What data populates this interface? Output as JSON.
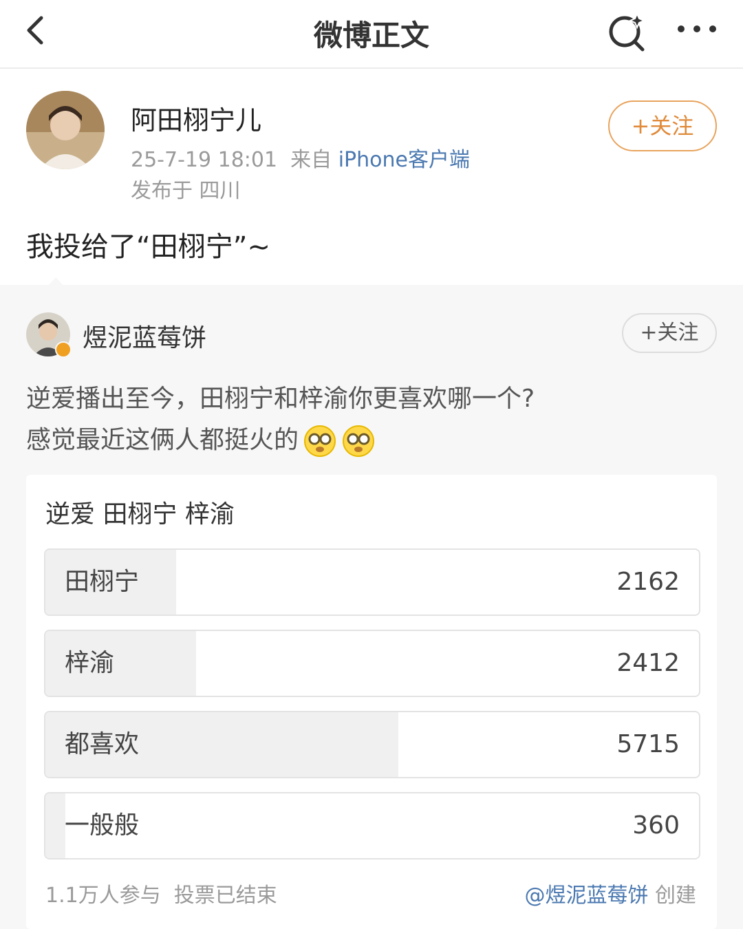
{
  "nav": {
    "title": "微博正文",
    "back_icon": "back-arrow-icon",
    "search_icon": "search-sparkle-icon",
    "more_icon": "more-dots-icon"
  },
  "post": {
    "author": "阿田栩宁儿",
    "time": "25-7-19 18:01",
    "source_prefix": "来自",
    "source": "iPhone客户端",
    "location": "发布于 四川",
    "follow_label": "+关注",
    "text": "我投给了“田栩宁”~"
  },
  "repost": {
    "author": "煜泥蓝莓饼",
    "follow_label": "+关注",
    "line1": "逆爱播出至今，田栩宁和梓渝你更喜欢哪一个?",
    "line2": "感觉最近这俩人都挺火的",
    "emoji_icon": "thinking-face-emoji"
  },
  "poll": {
    "title": "逆爱 田栩宁 梓渝",
    "options": [
      {
        "label": "田栩宁",
        "count": "2162",
        "share": 0.2
      },
      {
        "label": "梓渝",
        "count": "2412",
        "share": 0.23
      },
      {
        "label": "都喜欢",
        "count": "5715",
        "share": 0.54
      },
      {
        "label": "一般般",
        "count": "360",
        "share": 0.03
      }
    ],
    "participants": "1.1万人参与",
    "status": "投票已结束",
    "creator": "@煜泥蓝莓饼",
    "creator_suffix": "创建"
  },
  "colors": {
    "accent_orange": "#e08a3a",
    "link_blue": "#4a78b0",
    "muted_gray": "#9a9a9a",
    "poll_fill": "#f0f0f0"
  }
}
